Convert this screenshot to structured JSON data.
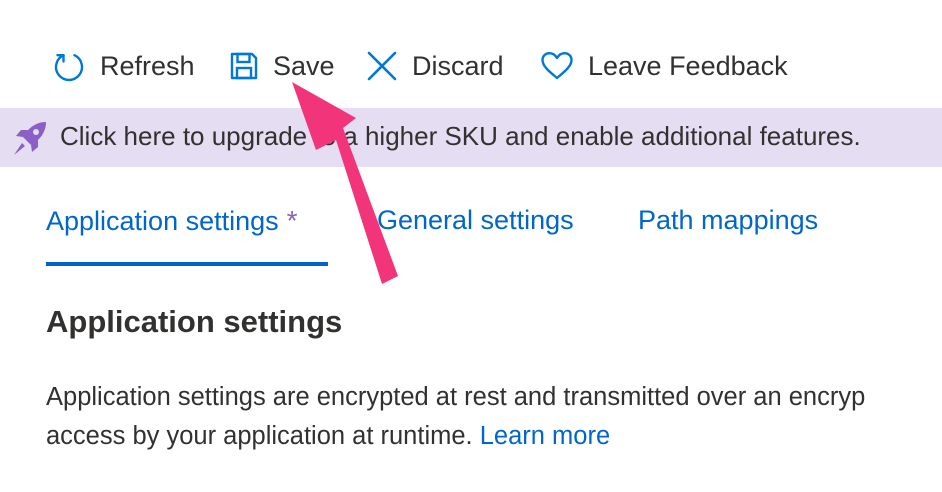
{
  "toolbar": {
    "refresh_label": "Refresh",
    "save_label": "Save",
    "discard_label": "Discard",
    "feedback_label": "Leave Feedback"
  },
  "banner": {
    "text": "Click here to upgrade to a higher SKU and enable additional features.",
    "icon": "rocket-icon",
    "background": "#e5ddf1",
    "icon_color": "#8a5fc6"
  },
  "tabs": [
    {
      "label": "Application settings",
      "modified_marker": "*",
      "selected": true
    },
    {
      "label": "General settings",
      "selected": false
    },
    {
      "label": "Path mappings",
      "selected": false
    }
  ],
  "section": {
    "title": "Application settings",
    "description_line1": "Application settings are encrypted at rest and transmitted over an encryp",
    "description_line2": "access by your application at runtime.",
    "learn_more": "Learn more"
  },
  "colors": {
    "accent": "#0066cc",
    "text": "#323130",
    "annotation_arrow": "#f2357a"
  }
}
